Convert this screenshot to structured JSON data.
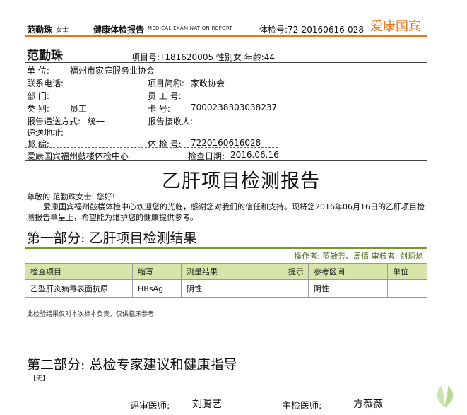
{
  "header": {
    "name": "范勤珠",
    "gender_title": "女士",
    "report_title": "健康体检报告",
    "report_title_en": "MEDICAL EXAMINATION REPORT",
    "exam_no": "体检号:72-20160616-028",
    "brand": "爱康国宾"
  },
  "patient": {
    "name": "范勤珠",
    "project_line": "项目号:T181620005  性别女  年龄:44"
  },
  "info": {
    "unit_label": "单      位:",
    "unit_value": "福州市家庭服务业协会",
    "phone_label": "联系电话:",
    "short_label": "项目简称:",
    "short_value": "家政协会",
    "dept_label": "部      门:",
    "empno_label": "员  工  号:",
    "type_label": "类      别:",
    "type_value": "员工",
    "card_label": "卡      号:",
    "card_value": "7000238303038237",
    "delivery_label": "报告递送方式:",
    "delivery_value": "统一",
    "receiver_label": "报告接收人:",
    "address_label": "递送地址:",
    "zip_label": "邮      编:",
    "examno_label": "体  检  号:",
    "examno_value": "7220160616028",
    "center": "爱康国宾福州鼓楼体检中心",
    "date_label": "检查日期:",
    "date_value": "2016.06.16"
  },
  "report": {
    "title": "乙肝项目检测报告",
    "greeting": "尊敬的 范勤珠女士: 您好!",
    "intro": "爱康国宾福州鼓楼体检中心欢迎您的光临，感谢您对我们的信任和支持。现将您2016年06月16日的乙肝项目检测报告单呈上，希望能为维护您的健康提供参考。"
  },
  "section1": {
    "title": "第一部分: 乙肝项目检测结果",
    "operators": "操作者: 蓝敏芳、周倩   审核者: 刘炳焰",
    "columns": [
      "检查项目",
      "缩写",
      "测量结果",
      "提示",
      "参考区间",
      "单位"
    ],
    "rows": [
      [
        "乙型肝炎病毒表面抗原",
        "HBsAg",
        "阴性",
        "",
        "阴性",
        ""
      ]
    ],
    "note": "此检验结果仅对本次标本负责，仅供临床参考"
  },
  "section2": {
    "title": "第二部分: 总检专家建议和健康指导",
    "content": "【无】"
  },
  "signatures": {
    "review_label": "评审医师:",
    "review_value": "刘腾艺",
    "chief_label": "主检医师:",
    "chief_value": "方薇薇"
  },
  "colors": {
    "brand": "#e8771e",
    "table_header": "#d6e6a8",
    "table_accent": "#6f9a2e"
  },
  "icons": {
    "watermark": "leaf-icon"
  }
}
